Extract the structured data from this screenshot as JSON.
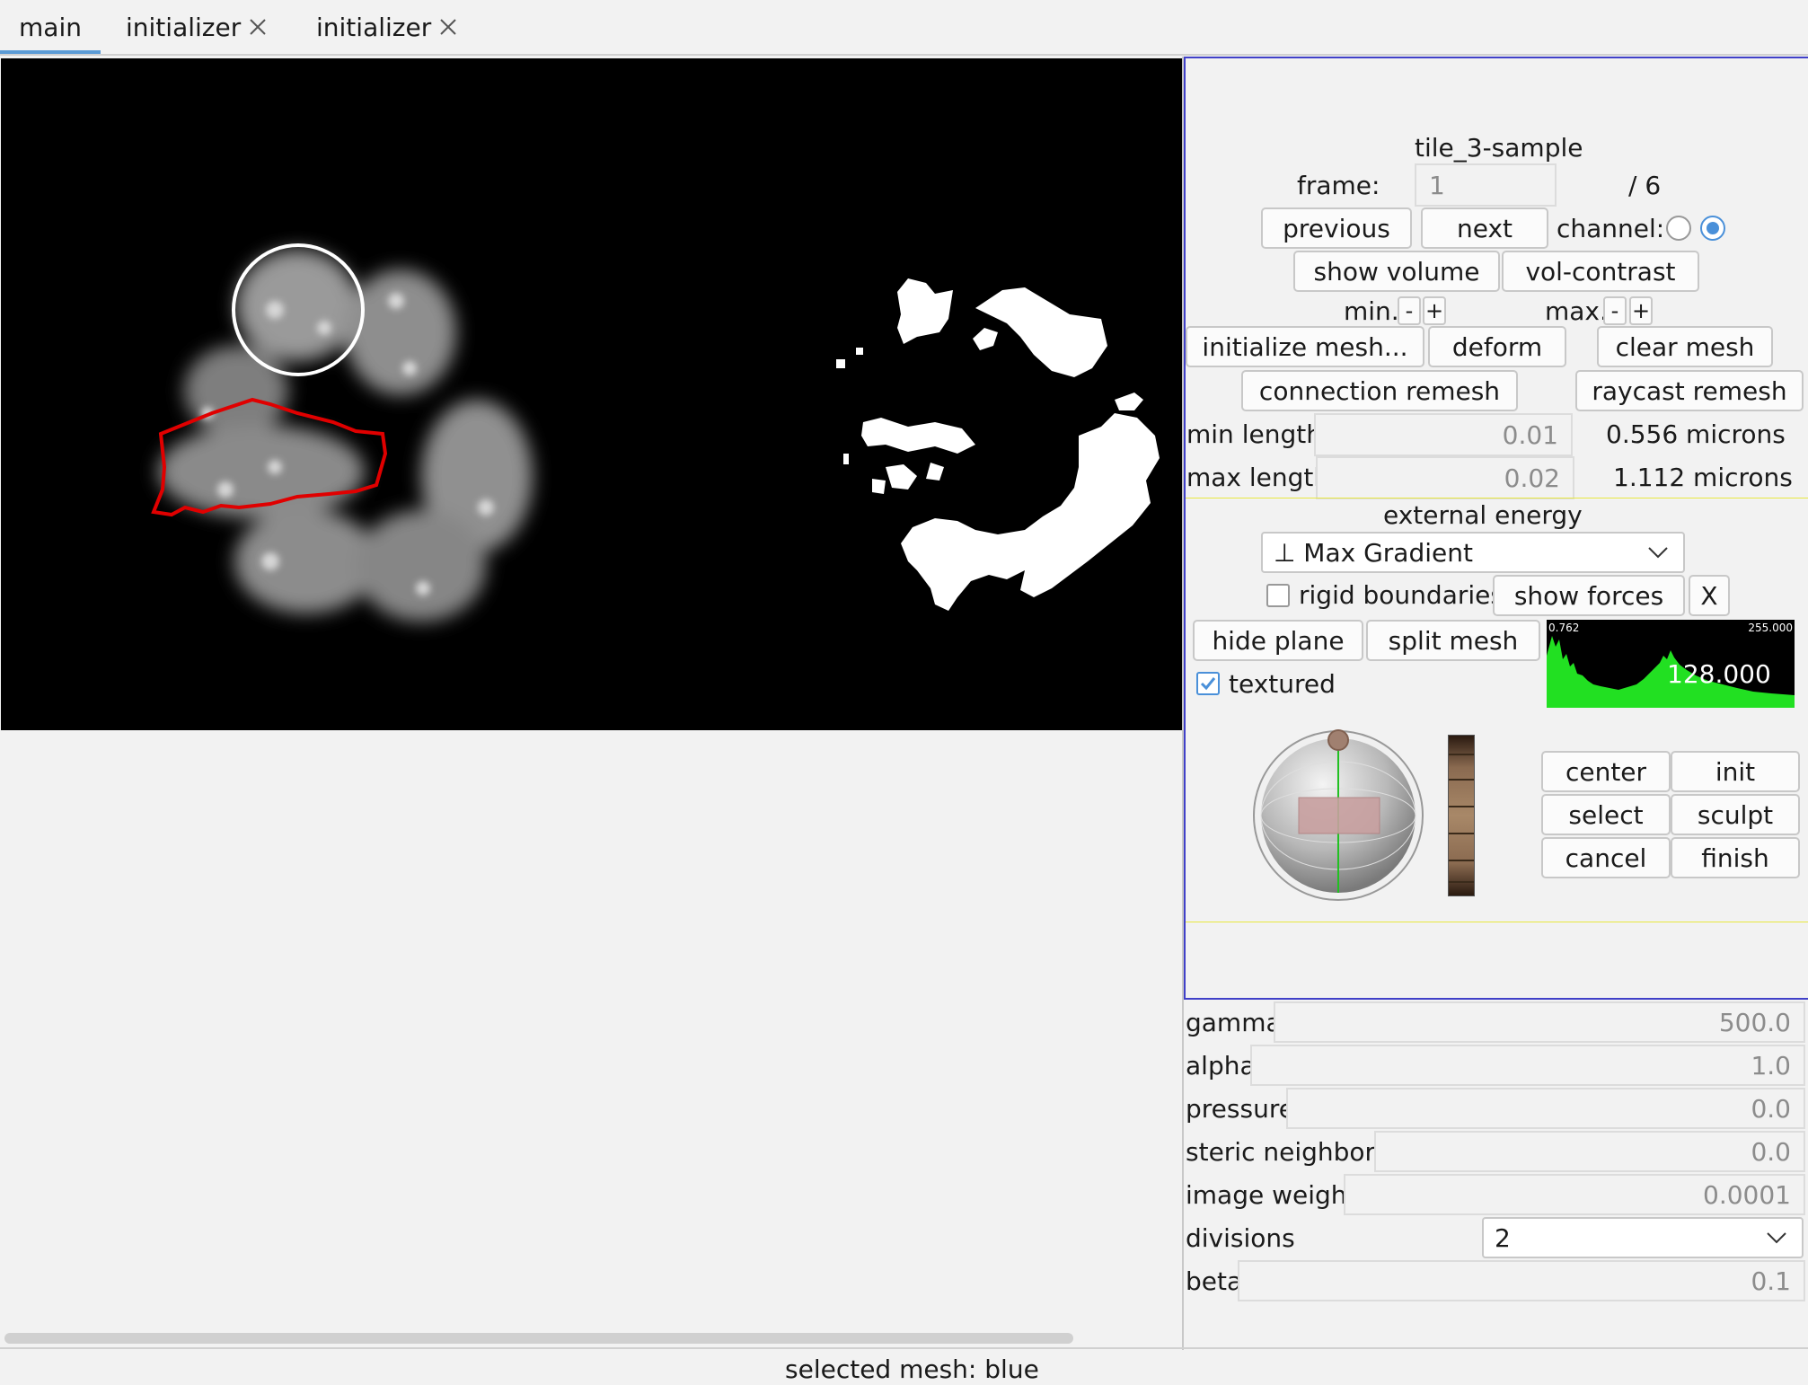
{
  "tabs": [
    {
      "label": "main",
      "active": true
    },
    {
      "label": "initializer",
      "closable": true
    },
    {
      "label": "initializer",
      "closable": true
    }
  ],
  "viewer": {
    "annotations": [
      {
        "shape": "circle",
        "color": "#ffffff"
      },
      {
        "shape": "outline",
        "color": "#e00000"
      }
    ]
  },
  "controls": {
    "image_name": "tile_3-sample",
    "frame_label": "frame:",
    "frame_value": "1",
    "frame_total": "/ 6",
    "previous_label": "previous",
    "next_label": "next",
    "channel_label": "channel:",
    "channel_selected": 2,
    "show_volume_label": "show volume",
    "vol_contrast_label": "vol-contrast",
    "min_label": "min.",
    "max_label": "max.",
    "minus": "-",
    "plus": "+",
    "initialize_mesh_label": "initialize mesh...",
    "deform_label": "deform",
    "clear_mesh_label": "clear mesh",
    "connection_remesh_label": "connection remesh",
    "raycast_remesh_label": "raycast remesh",
    "min_length_label": "min length",
    "min_length_value": "0.01",
    "min_length_microns": "0.556 microns",
    "max_length_label": "max length",
    "max_length_value": "0.02",
    "max_length_microns": "1.112 microns"
  },
  "energy": {
    "title": "external energy",
    "selected": "⊥ Max Gradient",
    "rigid_boundaries_label": "rigid boundaries",
    "rigid_boundaries_checked": false,
    "show_forces_label": "show forces",
    "x_label": "X",
    "hide_plane_label": "hide plane",
    "split_mesh_label": "split mesh",
    "textured_label": "textured",
    "textured_checked": true,
    "histogram": {
      "min_label": "0.762",
      "max_label": "255.000",
      "value_label": "128.000",
      "bar_color": "#22e022"
    },
    "center_label": "center",
    "init_label": "init",
    "select_label": "select",
    "sculpt_label": "sculpt",
    "cancel_label": "cancel",
    "finish_label": "finish"
  },
  "params": [
    {
      "label": "gamma",
      "value": "500.0"
    },
    {
      "label": "alpha",
      "value": "1.0"
    },
    {
      "label": "pressure",
      "value": "0.0"
    },
    {
      "label": "steric neighbors",
      "value": "0.0"
    },
    {
      "label": "image weight",
      "value": "0.0001"
    }
  ],
  "divisions": {
    "label": "divisions",
    "value": "2"
  },
  "beta": {
    "label": "beta",
    "value": "0.1"
  },
  "status": {
    "text": "selected mesh:  blue"
  },
  "colors": {
    "accent": "#4a90d9",
    "panel_border": "#4040c8",
    "energy_border": "#e8e840",
    "tab_underline": "#5b9bd5"
  }
}
